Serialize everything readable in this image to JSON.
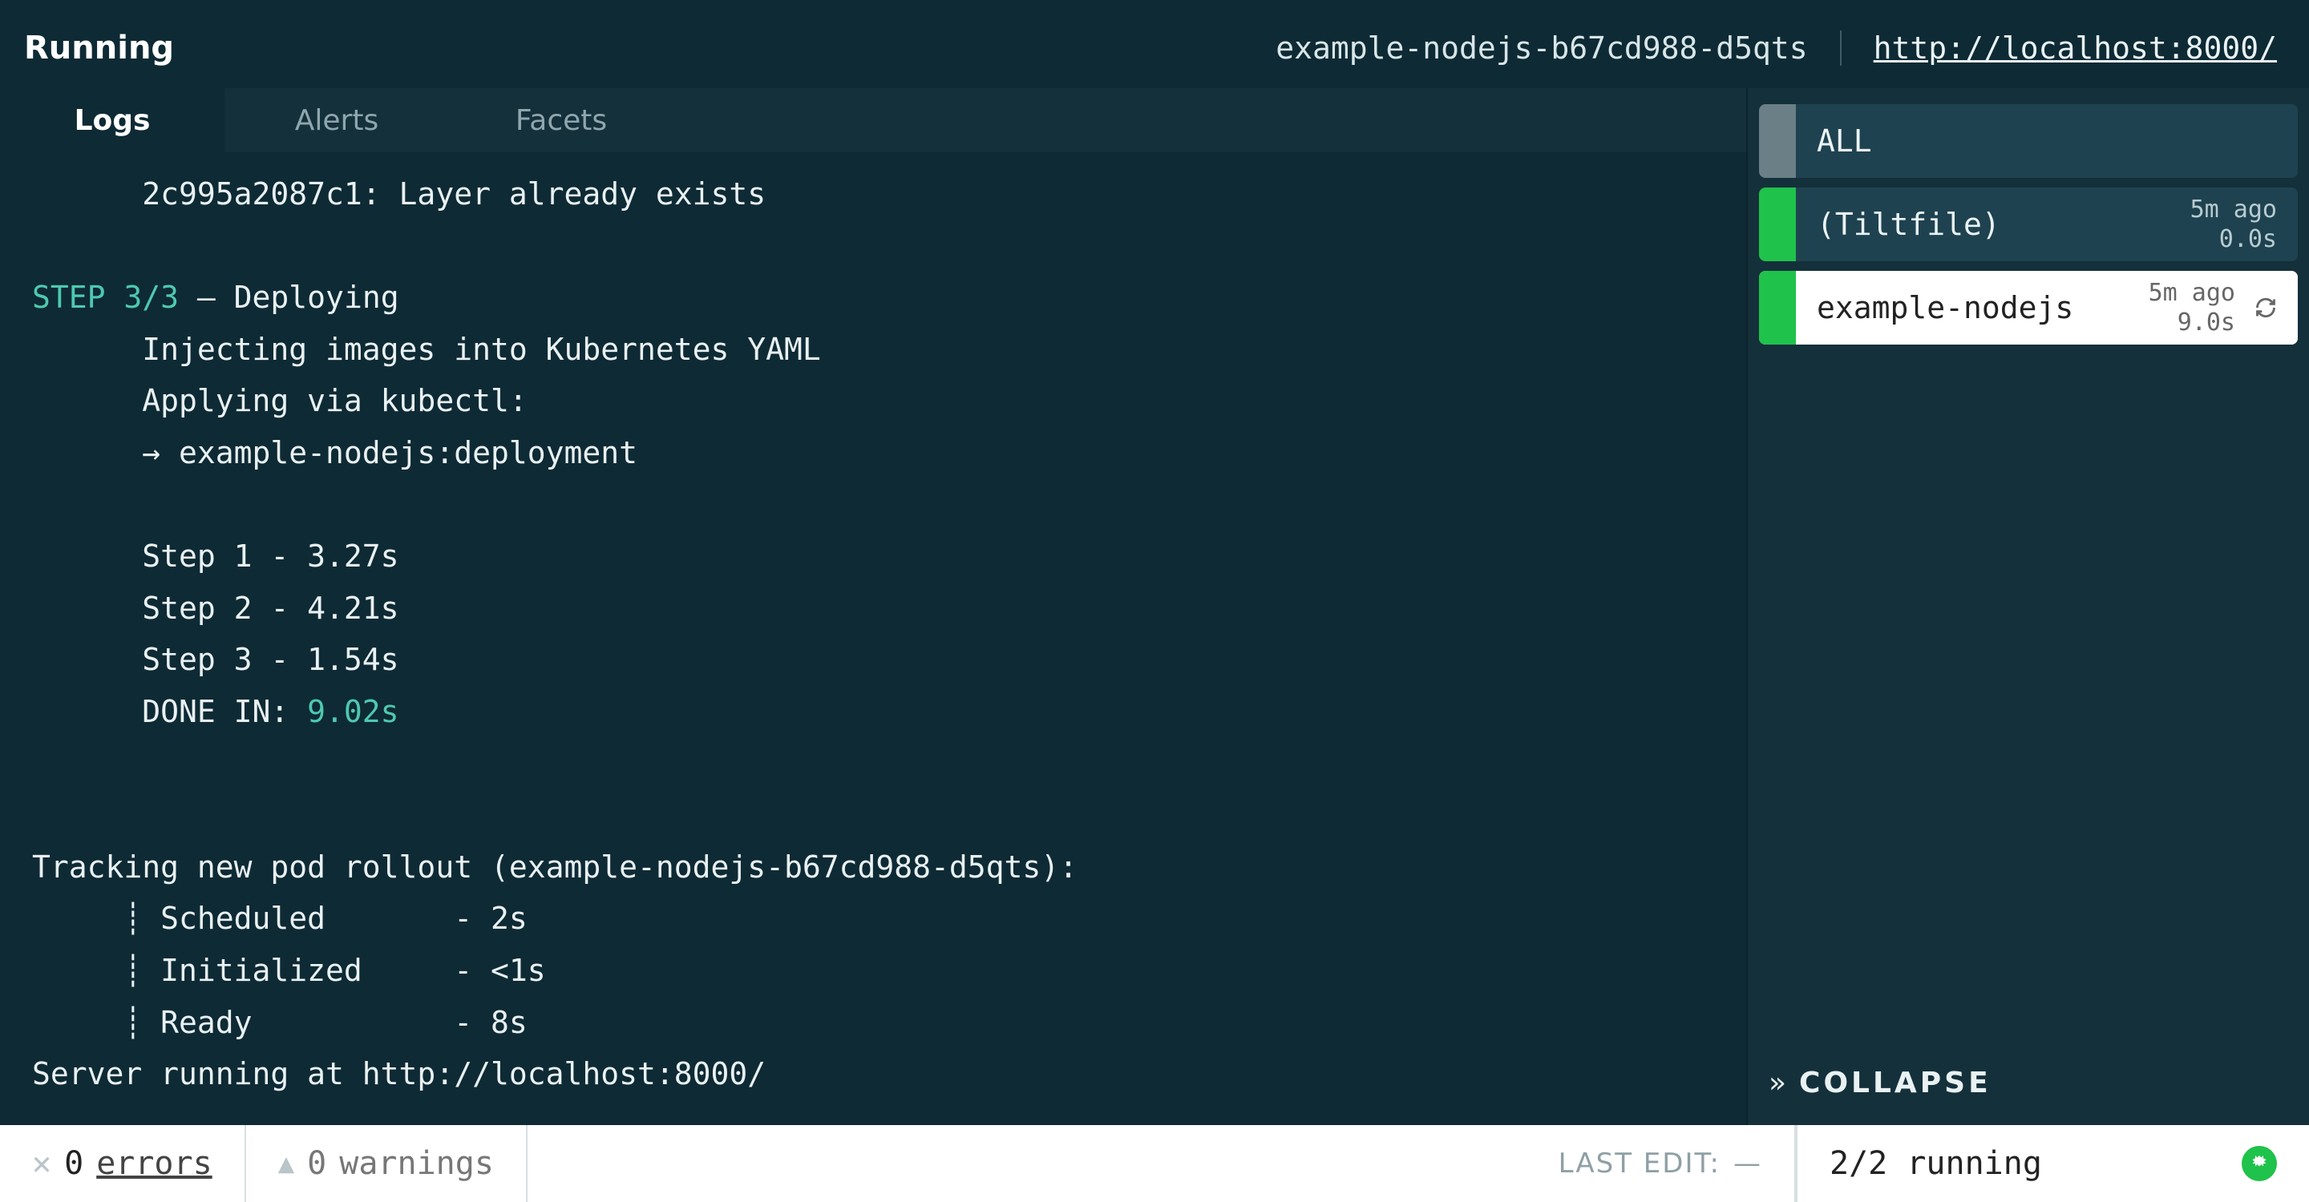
{
  "header": {
    "status": "Running",
    "pod_name": "example-nodejs-b67cd988-d5qts",
    "endpoint": "http://localhost:8000/"
  },
  "tabs": {
    "logs": "Logs",
    "alerts": "Alerts",
    "facets": "Facets",
    "active": "logs"
  },
  "logs": {
    "line_push": "      2c995a2087c1: Layer already exists",
    "step_label": "STEP 3/3",
    "step_sep": " — ",
    "step_title": "Deploying",
    "inject": "      Injecting images into Kubernetes YAML",
    "apply": "      Applying via kubectl:",
    "apply_target": "      → example-nodejs:deployment",
    "t1": "      Step 1 - 3.27s",
    "t2": "      Step 2 - 4.21s",
    "t3": "      Step 3 - 1.54s",
    "done_prefix": "      DONE IN: ",
    "done_time": "9.02s",
    "track": "Tracking new pod rollout (example-nodejs-b67cd988-d5qts):",
    "pod1": "     ┊ Scheduled       - 2s",
    "pod2": "     ┊ Initialized     - <1s",
    "pod3": "     ┊ Ready           - 8s",
    "server": "Server running at http://localhost:8000/"
  },
  "sidebar": {
    "all": "ALL",
    "items": [
      {
        "name": "(Tiltfile)",
        "ago": "5m ago",
        "dur": "0.0s"
      },
      {
        "name": "example-nodejs",
        "ago": "5m ago",
        "dur": "9.0s"
      }
    ],
    "collapse": "COLLAPSE"
  },
  "footer": {
    "errors_count": "0",
    "errors_label": "errors",
    "warnings_count": "0",
    "warnings_label": "warnings",
    "last_edit_label": "LAST EDIT:",
    "last_edit_value": "—",
    "running": "2/2 running"
  }
}
